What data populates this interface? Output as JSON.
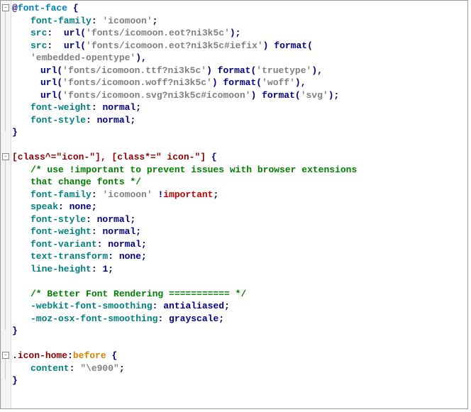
{
  "blocks": [
    {
      "header_parts": [
        {
          "t": "@",
          "c": "punct"
        },
        {
          "t": "font-face",
          "c": "atrule"
        },
        {
          "t": " {",
          "c": "punct"
        }
      ],
      "lines": [
        [
          {
            "t": "font-family",
            "c": "prop"
          },
          {
            "t": ": ",
            "c": "punct"
          },
          {
            "t": "'icomoon'",
            "c": "string"
          },
          {
            "t": ";",
            "c": "punct"
          }
        ],
        [
          {
            "t": "src",
            "c": "prop"
          },
          {
            "t": ":  ",
            "c": "punct"
          },
          {
            "t": "url",
            "c": "value"
          },
          {
            "t": "(",
            "c": "punct"
          },
          {
            "t": "'fonts/icomoon.eot?ni3k5c'",
            "c": "string"
          },
          {
            "t": ");",
            "c": "punct"
          }
        ],
        [
          {
            "t": "src",
            "c": "prop"
          },
          {
            "t": ":  ",
            "c": "punct"
          },
          {
            "t": "url",
            "c": "value"
          },
          {
            "t": "(",
            "c": "punct"
          },
          {
            "t": "'fonts/icomoon.eot?ni3k5c#iefix'",
            "c": "string"
          },
          {
            "t": ") ",
            "c": "punct"
          },
          {
            "t": "format",
            "c": "value"
          },
          {
            "t": "(",
            "c": "punct"
          }
        ],
        [
          {
            "t": "'embedded-opentype'",
            "c": "string",
            "indent": "indent1_at0"
          },
          {
            "t": "),",
            "c": "punct"
          }
        ],
        [
          {
            "t": "url",
            "c": "value",
            "indent": "indent2_at0"
          },
          {
            "t": "(",
            "c": "punct"
          },
          {
            "t": "'fonts/icomoon.ttf?ni3k5c'",
            "c": "string"
          },
          {
            "t": ") ",
            "c": "punct"
          },
          {
            "t": "format",
            "c": "value"
          },
          {
            "t": "(",
            "c": "punct"
          },
          {
            "t": "'truetype'",
            "c": "string"
          },
          {
            "t": "),",
            "c": "punct"
          }
        ],
        [
          {
            "t": "url",
            "c": "value",
            "indent": "indent2_at0"
          },
          {
            "t": "(",
            "c": "punct"
          },
          {
            "t": "'fonts/icomoon.woff?ni3k5c'",
            "c": "string"
          },
          {
            "t": ") ",
            "c": "punct"
          },
          {
            "t": "format",
            "c": "value"
          },
          {
            "t": "(",
            "c": "punct"
          },
          {
            "t": "'woff'",
            "c": "string"
          },
          {
            "t": "),",
            "c": "punct"
          }
        ],
        [
          {
            "t": "url",
            "c": "value",
            "indent": "indent2_at0"
          },
          {
            "t": "(",
            "c": "punct"
          },
          {
            "t": "'fonts/icomoon.svg?ni3k5c#icomoon'",
            "c": "string"
          },
          {
            "t": ") ",
            "c": "punct"
          },
          {
            "t": "format",
            "c": "value"
          },
          {
            "t": "(",
            "c": "punct"
          },
          {
            "t": "'svg'",
            "c": "string"
          },
          {
            "t": ");",
            "c": "punct"
          }
        ],
        [
          {
            "t": "font-weight",
            "c": "prop"
          },
          {
            "t": ": ",
            "c": "punct"
          },
          {
            "t": "normal",
            "c": "value"
          },
          {
            "t": ";",
            "c": "punct"
          }
        ],
        [
          {
            "t": "font-style",
            "c": "prop"
          },
          {
            "t": ": ",
            "c": "punct"
          },
          {
            "t": "normal",
            "c": "value"
          },
          {
            "t": ";",
            "c": "punct"
          }
        ]
      ],
      "close": "}"
    },
    {
      "gap_before": 1,
      "header_parts": [
        {
          "t": "[class^=\"icon-\"], [class*=\" icon-\"]",
          "c": "selector"
        },
        {
          "t": " {",
          "c": "punct"
        }
      ],
      "lines": [
        [
          {
            "t": "/* use !important to prevent issues with browser extensions that change fonts */",
            "c": "comment",
            "wrap": true
          }
        ],
        [
          {
            "t": "font-family",
            "c": "prop"
          },
          {
            "t": ": ",
            "c": "punct"
          },
          {
            "t": "'icomoon'",
            "c": "string"
          },
          {
            "t": " !",
            "c": "punct"
          },
          {
            "t": "important",
            "c": "important"
          },
          {
            "t": ";",
            "c": "punct"
          }
        ],
        [
          {
            "t": "speak",
            "c": "prop"
          },
          {
            "t": ": ",
            "c": "punct"
          },
          {
            "t": "none",
            "c": "value"
          },
          {
            "t": ";",
            "c": "punct"
          }
        ],
        [
          {
            "t": "font-style",
            "c": "prop"
          },
          {
            "t": ": ",
            "c": "punct"
          },
          {
            "t": "normal",
            "c": "value"
          },
          {
            "t": ";",
            "c": "punct"
          }
        ],
        [
          {
            "t": "font-weight",
            "c": "prop"
          },
          {
            "t": ": ",
            "c": "punct"
          },
          {
            "t": "normal",
            "c": "value"
          },
          {
            "t": ";",
            "c": "punct"
          }
        ],
        [
          {
            "t": "font-variant",
            "c": "prop"
          },
          {
            "t": ": ",
            "c": "punct"
          },
          {
            "t": "normal",
            "c": "value"
          },
          {
            "t": ";",
            "c": "punct"
          }
        ],
        [
          {
            "t": "text-transform",
            "c": "prop"
          },
          {
            "t": ": ",
            "c": "punct"
          },
          {
            "t": "none",
            "c": "value"
          },
          {
            "t": ";",
            "c": "punct"
          }
        ],
        [
          {
            "t": "line-height",
            "c": "prop"
          },
          {
            "t": ": ",
            "c": "punct"
          },
          {
            "t": "1",
            "c": "value"
          },
          {
            "t": ";",
            "c": "punct"
          }
        ],
        [],
        [
          {
            "t": "/* Better Font Rendering =========== */",
            "c": "comment"
          }
        ],
        [
          {
            "t": "-webkit-font-smoothing",
            "c": "prop"
          },
          {
            "t": ": ",
            "c": "punct"
          },
          {
            "t": "antialiased",
            "c": "value"
          },
          {
            "t": ";",
            "c": "punct"
          }
        ],
        [
          {
            "t": "-moz-osx-font-smoothing",
            "c": "prop"
          },
          {
            "t": ": ",
            "c": "punct"
          },
          {
            "t": "grayscale",
            "c": "value"
          },
          {
            "t": ";",
            "c": "punct"
          }
        ]
      ],
      "close": "}"
    },
    {
      "gap_before": 1,
      "header_parts": [
        {
          "t": ".",
          "c": "punct"
        },
        {
          "t": "icon-home",
          "c": "class"
        },
        {
          "t": ":",
          "c": "punct"
        },
        {
          "t": "before",
          "c": "pseudo"
        },
        {
          "t": " {",
          "c": "punct"
        }
      ],
      "lines": [
        [
          {
            "t": "content",
            "c": "prop"
          },
          {
            "t": ": ",
            "c": "punct"
          },
          {
            "t": "\"\\e900\"",
            "c": "string"
          },
          {
            "t": ";",
            "c": "punct"
          }
        ]
      ],
      "close": "}"
    }
  ]
}
